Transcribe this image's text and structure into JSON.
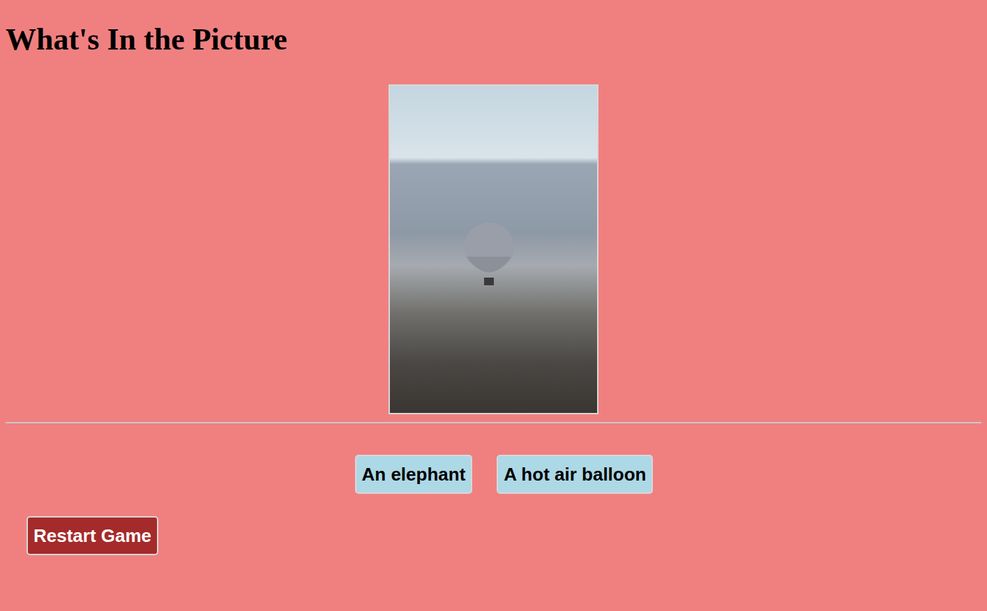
{
  "title": "What's In the Picture",
  "options": [
    {
      "label": "An elephant"
    },
    {
      "label": "A hot air balloon"
    }
  ],
  "restart_button": "Restart Game"
}
